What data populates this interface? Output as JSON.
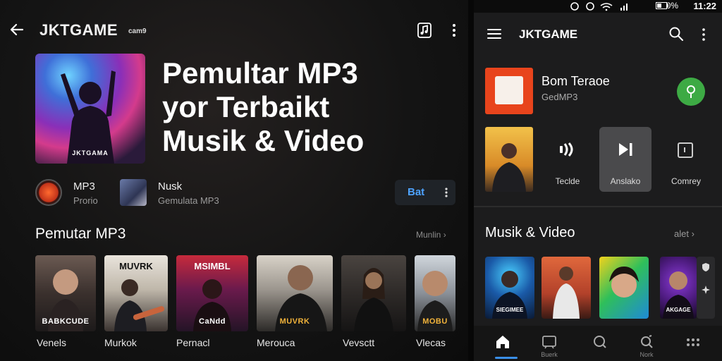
{
  "left": {
    "header": {
      "title": "JKTGAME",
      "subtitle": "cam9"
    },
    "hero": {
      "art_text": "JKTGAMA",
      "title_lines": [
        "Pemultar MP3",
        "yor Terbaikt",
        "Musik & Video"
      ]
    },
    "sources": [
      {
        "label": "MP3",
        "sub": "Prorio"
      },
      {
        "label": "Nusk",
        "sub": "Gemulata MP3"
      }
    ],
    "pill_label": "Bat",
    "section": {
      "title": "Pemutar MP3",
      "more": "Munlin"
    },
    "cards": [
      {
        "label": "Venels",
        "text": "BABKCUDE",
        "top_text": ""
      },
      {
        "label": "Murkok",
        "text": "",
        "top_text": "MUVRK"
      },
      {
        "label": "Pernacl",
        "text": "CaNdd",
        "top_text": "MSIMBL"
      },
      {
        "label": "Merouca",
        "text": "MUVRK",
        "top_text": ""
      },
      {
        "label": "Vevsctt",
        "text": "",
        "top_text": ""
      },
      {
        "label": "Vlecas",
        "text": "MOBU",
        "top_text": ""
      }
    ]
  },
  "right": {
    "status": {
      "battery": "0%",
      "time": "11:22"
    },
    "title": "JKTGAME",
    "now_playing": {
      "title": "Bom Teraoe",
      "sub": "GedMP3"
    },
    "controls": [
      {
        "label": "Teclde",
        "glyph": "icon-waves"
      },
      {
        "label": "Anslako",
        "glyph": "icon-skip"
      },
      {
        "label": "Comrey",
        "glyph": "icon-square"
      }
    ],
    "section": {
      "title": "Musik & Video",
      "more": "alet"
    },
    "cards": [
      {
        "text": "SIEGIMEE"
      },
      {
        "text": ""
      },
      {
        "text": ""
      },
      {
        "text": "AKGAGE"
      }
    ],
    "nav": [
      {
        "icon": "home-icon",
        "label": ""
      },
      {
        "icon": "library-icon",
        "label": "Buerk"
      },
      {
        "icon": "search-icon",
        "label": ""
      },
      {
        "icon": "discover-icon",
        "label": "Nork"
      },
      {
        "icon": "more-icon",
        "label": ""
      }
    ]
  },
  "colors": {
    "accent": "#4ea3ff",
    "green": "#3daa44",
    "orange": "#e8441c",
    "nav_indicator": "#3a8fe8"
  }
}
